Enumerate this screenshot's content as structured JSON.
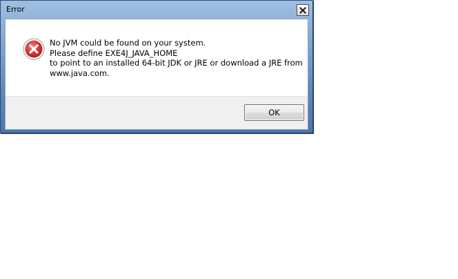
{
  "window": {
    "title": "Error",
    "close_icon": "close-icon"
  },
  "message": {
    "icon": "error-icon",
    "lines": [
      "No JVM could be found on your system.",
      "Please define EXE4J_JAVA_HOME",
      "to point to an installed 64-bit JDK or JRE or download a JRE from",
      "www.java.com."
    ]
  },
  "buttons": {
    "ok_label": "OK"
  },
  "colors": {
    "error_red": "#d93636",
    "titlebar_blue": "#7fa3cc",
    "footer_gray": "#f0f0f0"
  }
}
